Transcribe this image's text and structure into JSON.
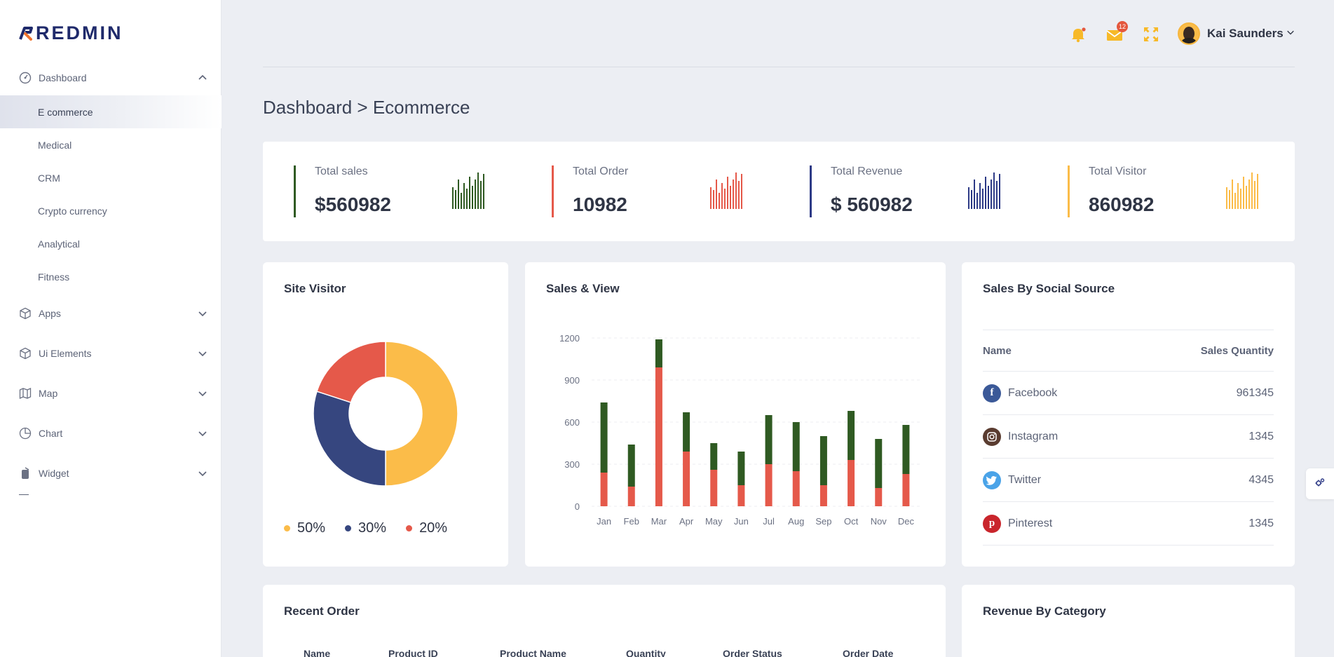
{
  "brand": {
    "name": "REDMIN"
  },
  "sidebar": {
    "dashboard": "Dashboard",
    "sub_items": [
      "E commerce",
      "Medical",
      "CRM",
      "Crypto currency",
      "Analytical",
      "Fitness"
    ],
    "groups": [
      "Apps",
      "Ui Elements",
      "Map",
      "Chart",
      "Widget"
    ]
  },
  "topbar": {
    "mail_badge": "12",
    "user_name": "Kai Saunders"
  },
  "breadcrumb": "Dashboard > Ecommerce",
  "stats": [
    {
      "label": "Total sales",
      "value": "$560982",
      "color": "#2f5a22"
    },
    {
      "label": "Total Order",
      "value": "10982",
      "color": "#e5594a"
    },
    {
      "label": "Total Revenue",
      "value": "$ 560982",
      "color": "#2d3a86"
    },
    {
      "label": "Total Visitor",
      "value": "860982",
      "color": "#fbbc49"
    }
  ],
  "site_visitor": {
    "title": "Site Visitor",
    "legend": [
      {
        "label": "50%",
        "color": "#fbbc49"
      },
      {
        "label": "30%",
        "color": "#36467f"
      },
      {
        "label": "20%",
        "color": "#e5594a"
      }
    ]
  },
  "sales_view": {
    "title": "Sales & View"
  },
  "social": {
    "title": "Sales By Social Source",
    "col_name": "Name",
    "col_qty": "Sales Quantity",
    "rows": [
      {
        "name": "Facebook",
        "qty": "961345",
        "color": "#3b5998",
        "icon": "facebook-icon"
      },
      {
        "name": "Instagram",
        "qty": "1345",
        "color": "#5a3c30",
        "icon": "instagram-icon"
      },
      {
        "name": "Twitter",
        "qty": "4345",
        "color": "#4aa3e8",
        "icon": "twitter-icon"
      },
      {
        "name": "Pinterest",
        "qty": "1345",
        "color": "#c9252c",
        "icon": "pinterest-icon"
      }
    ]
  },
  "recent_order": {
    "title": "Recent Order",
    "columns": [
      "Name",
      "Product ID",
      "Product Name",
      "Quantity",
      "Order Status",
      "Order Date"
    ]
  },
  "revenue_category": {
    "title": "Revenue By Category"
  },
  "chart_data": [
    {
      "type": "pie",
      "categories": [
        "50%",
        "30%",
        "20%"
      ],
      "values": [
        50,
        30,
        20
      ],
      "colors": [
        "#fbbc49",
        "#36467f",
        "#e5594a"
      ],
      "donut": true
    },
    {
      "type": "bar",
      "stacked": true,
      "categories": [
        "Jan",
        "Feb",
        "Mar",
        "Apr",
        "May",
        "Jun",
        "Jul",
        "Aug",
        "Sep",
        "Oct",
        "Nov",
        "Dec"
      ],
      "series": [
        {
          "values": [
            240,
            140,
            990,
            390,
            260,
            150,
            300,
            250,
            150,
            330,
            130,
            230
          ],
          "color": "#e5594a"
        },
        {
          "values": [
            500,
            300,
            200,
            280,
            190,
            240,
            350,
            350,
            350,
            350,
            350,
            350
          ],
          "color": "#2f5a22"
        }
      ],
      "yticks": [
        0,
        300,
        600,
        900,
        1200
      ],
      "ylim": [
        0,
        1200
      ],
      "grid": true
    }
  ],
  "sparklines": [
    [
      30,
      26,
      40,
      22,
      36,
      28,
      44,
      32,
      40,
      50,
      38,
      48
    ],
    [
      30,
      26,
      40,
      22,
      36,
      28,
      44,
      32,
      40,
      50,
      38,
      48
    ],
    [
      30,
      26,
      40,
      22,
      36,
      28,
      44,
      32,
      40,
      50,
      38,
      48
    ],
    [
      30,
      26,
      40,
      22,
      36,
      28,
      44,
      32,
      40,
      50,
      38,
      48
    ]
  ]
}
